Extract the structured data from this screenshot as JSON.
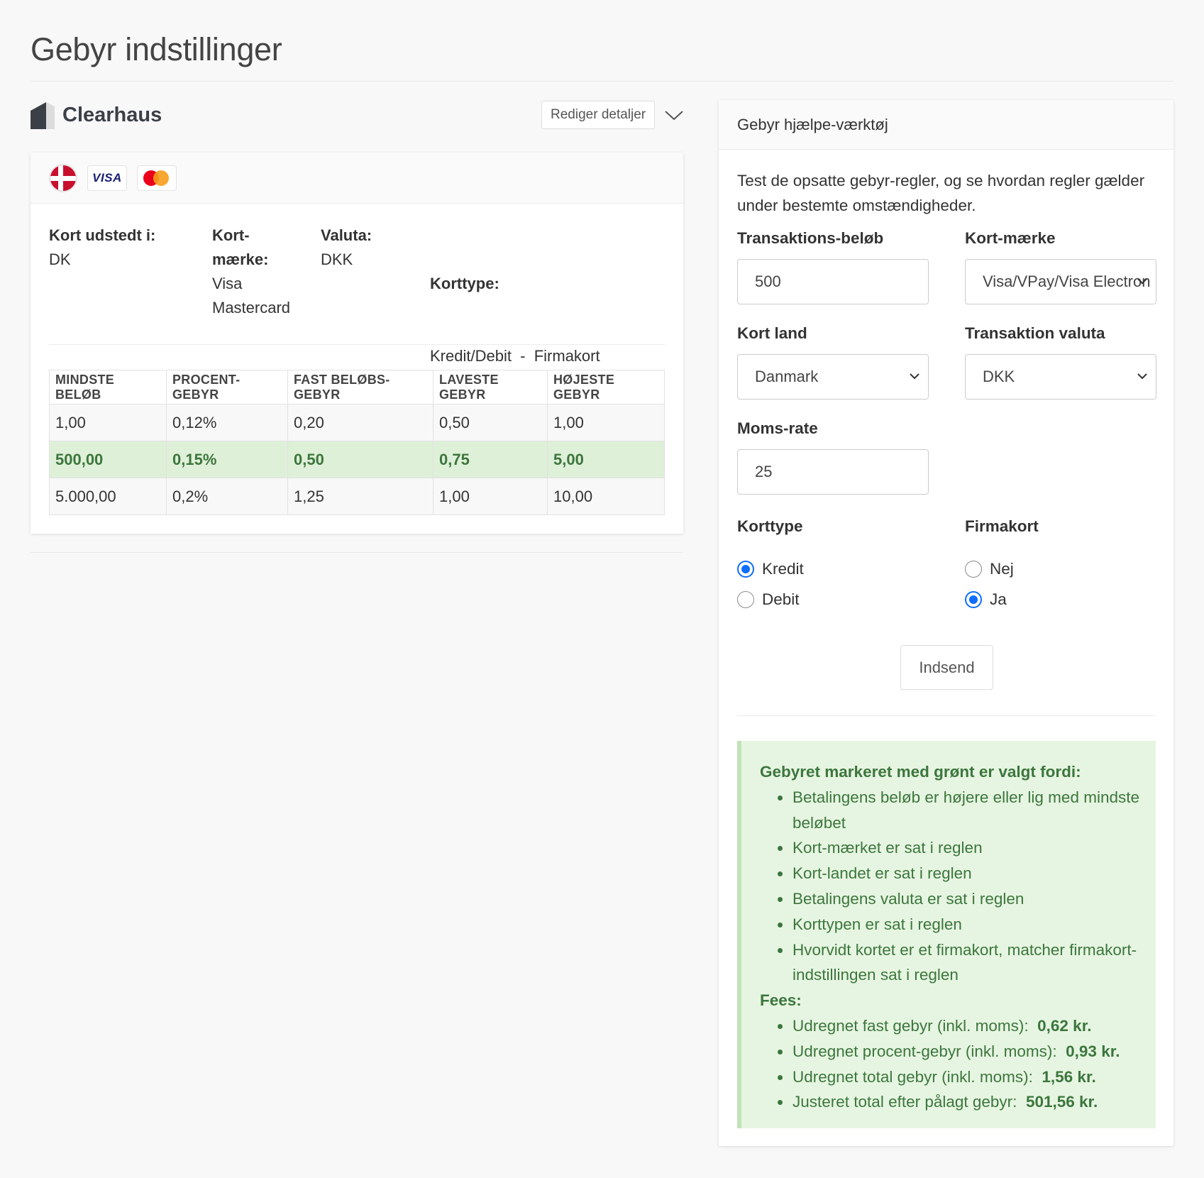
{
  "page": {
    "title": "Gebyr indstillinger"
  },
  "provider": {
    "name": "Clearhaus",
    "edit_label": "Rediger detaljer",
    "rule": {
      "issued_in_label": "Kort udstedt i:",
      "issued_in_value": "DK",
      "brand_label_1": "Kort-",
      "brand_label_2": "mærke:",
      "brands": [
        "Visa",
        "Mastercard"
      ],
      "brand_badge_visa": "VISA",
      "currency_label": "Valuta:",
      "currency_value": "DKK",
      "cardtype_label": "Korttype:",
      "cardtype_value": "Kredit/Debit  -  Firmakort"
    },
    "table": {
      "headers": [
        "MINDSTE BELØB",
        "PROCENT-GEBYR",
        "FAST BELØBS-GEBYR",
        "LAVESTE GEBYR",
        "HØJESTE GEBYR"
      ],
      "rows": [
        [
          "1,00",
          "0,12%",
          "0,20",
          "0,50",
          "1,00"
        ],
        [
          "500,00",
          "0,15%",
          "0,50",
          "0,75",
          "5,00"
        ],
        [
          "5.000,00",
          "0,2%",
          "1,25",
          "1,00",
          "10,00"
        ]
      ],
      "selected_row": 1
    }
  },
  "tool": {
    "title": "Gebyr hjælpe-værktøj",
    "intro": "Test de opsatte gebyr-regler, og se hvordan regler gælder under bestemte omstændigheder.",
    "amount_label": "Transaktions-beløb",
    "amount_value": "500",
    "brand_label": "Kort-mærke",
    "brand_value": "Visa/VPay/Visa Electron",
    "country_label": "Kort land",
    "country_value": "Danmark",
    "currency_label": "Transaktion valuta",
    "currency_value": "DKK",
    "vat_label": "Moms-rate",
    "vat_value": "25",
    "cardtype_label": "Korttype",
    "cardtype_options": [
      "Kredit",
      "Debit"
    ],
    "cardtype_selected": "Kredit",
    "corporate_label": "Firmakort",
    "corporate_options": [
      "Nej",
      "Ja"
    ],
    "corporate_selected": "Ja",
    "submit_label": "Indsend",
    "result": {
      "reason_heading": "Gebyret markeret med grønt er valgt fordi:",
      "reasons": [
        "Betalingens beløb er højere eller lig med mindste beløbet",
        "Kort-mærket er sat i reglen",
        "Kort-landet er sat i reglen",
        "Betalingens valuta er sat i reglen",
        "Korttypen er sat i reglen",
        "Hvorvidt kortet er et firmakort, matcher firmakort-indstillingen sat i reglen"
      ],
      "fees_heading": "Fees:",
      "fees": [
        {
          "label": "Udregnet fast gebyr (inkl. moms):",
          "value": "0,62 kr."
        },
        {
          "label": "Udregnet procent-gebyr (inkl. moms):",
          "value": "0,93 kr."
        },
        {
          "label": "Udregnet total gebyr (inkl. moms):",
          "value": "1,56 kr."
        },
        {
          "label": "Justeret total efter pålagt gebyr:",
          "value": "501,56 kr."
        }
      ]
    }
  },
  "colors": {
    "selected_row_bg": "#dff0d8",
    "success_text": "#3c763d",
    "radio_accent": "#0d6efd"
  },
  "icons": {
    "provider_logo": "clearhaus-logo-icon",
    "collapse": "chevron-down-icon",
    "flag": "flag-denmark-icon",
    "visa": "visa-icon",
    "mastercard": "mastercard-icon"
  }
}
